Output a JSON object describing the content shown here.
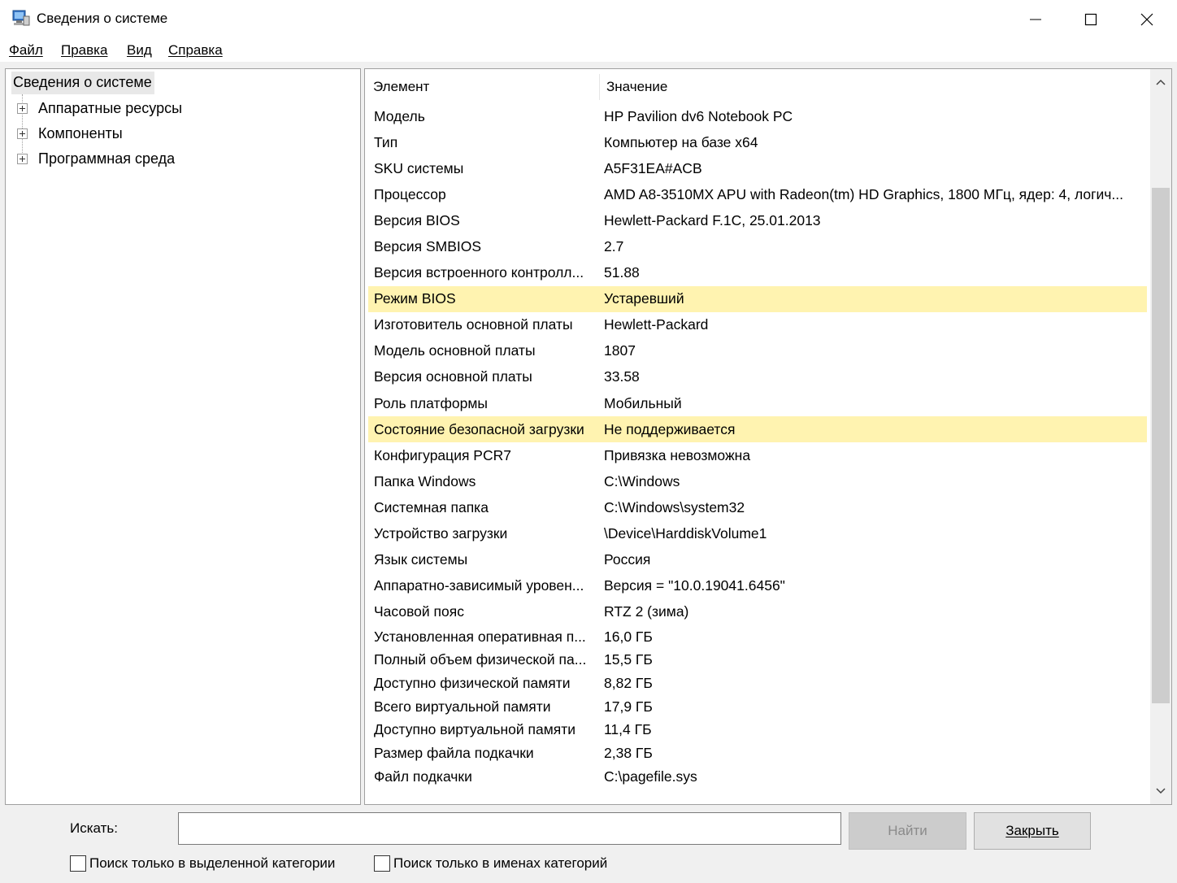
{
  "window": {
    "title": "Сведения о системе",
    "icon": "system-info-icon"
  },
  "menu": [
    {
      "label": "Файл"
    },
    {
      "label": "Правка"
    },
    {
      "label": "Вид"
    },
    {
      "label": "Справка"
    }
  ],
  "tree": {
    "root": "Сведения о системе",
    "children": [
      {
        "label": "Аппаратные ресурсы"
      },
      {
        "label": "Компоненты"
      },
      {
        "label": "Программная среда"
      }
    ]
  },
  "details": {
    "columns": {
      "name": "Элемент",
      "value": "Значение"
    },
    "highlight_color": "#fff3b0",
    "rows": [
      {
        "name": "Модель",
        "value": "HP Pavilion dv6 Notebook PC"
      },
      {
        "name": "Тип",
        "value": "Компьютер на базе x64"
      },
      {
        "name": "SKU системы",
        "value": "A5F31EA#ACB"
      },
      {
        "name": "Процессор",
        "value": "AMD A8-3510MX APU with Radeon(tm) HD Graphics, 1800 МГц, ядер: 4, логич..."
      },
      {
        "name": "Версия BIOS",
        "value": "Hewlett-Packard F.1C, 25.01.2013"
      },
      {
        "name": "Версия SMBIOS",
        "value": "2.7"
      },
      {
        "name": "Версия встроенного контролл...",
        "value": "51.88"
      },
      {
        "name": "Режим BIOS",
        "value": "Устаревший",
        "highlight": true
      },
      {
        "name": "Изготовитель основной платы",
        "value": "Hewlett-Packard"
      },
      {
        "name": "Модель основной платы",
        "value": "1807"
      },
      {
        "name": "Версия основной платы",
        "value": "33.58"
      },
      {
        "name": "Роль платформы",
        "value": "Мобильный"
      },
      {
        "name": "Состояние безопасной загрузки",
        "value": "Не поддерживается",
        "highlight": true
      },
      {
        "name": "Конфигурация PCR7",
        "value": "Привязка невозможна"
      },
      {
        "name": "Папка Windows",
        "value": "C:\\Windows"
      },
      {
        "name": "Системная папка",
        "value": "C:\\Windows\\system32"
      },
      {
        "name": "Устройство загрузки",
        "value": "\\Device\\HarddiskVolume1"
      },
      {
        "name": "Язык системы",
        "value": "Россия"
      },
      {
        "name": "Аппаратно-зависимый уровен...",
        "value": "Версия = \"10.0.19041.6456\""
      },
      {
        "name": "Часовой пояс",
        "value": "RTZ 2 (зима)"
      },
      {
        "name": "Установленная оперативная п...",
        "value": "16,0 ГБ"
      },
      {
        "name": "Полный объем физической па...",
        "value": "15,5 ГБ"
      },
      {
        "name": "Доступно физической памяти",
        "value": "8,82 ГБ"
      },
      {
        "name": "Всего виртуальной памяти",
        "value": "17,9 ГБ"
      },
      {
        "name": "Доступно виртуальной памяти",
        "value": "11,4 ГБ"
      },
      {
        "name": "Размер файла подкачки",
        "value": "2,38 ГБ"
      },
      {
        "name": "Файл подкачки",
        "value": "C:\\pagefile.sys"
      }
    ]
  },
  "search": {
    "label": "Искать:",
    "value": "",
    "find_label": "Найти",
    "close_label": "Закрыть",
    "only_selected_category": "Поиск только в выделенной категории",
    "only_category_names": "Поиск только в именах категорий"
  }
}
